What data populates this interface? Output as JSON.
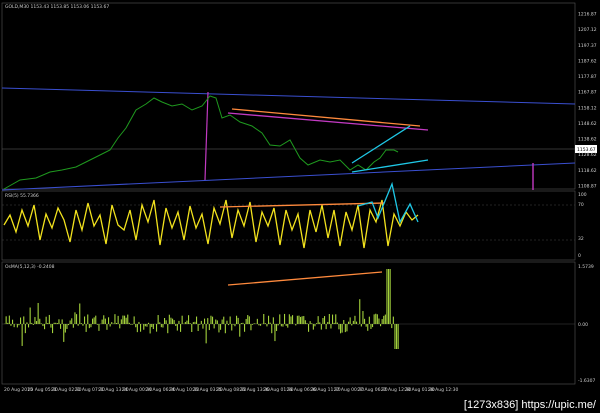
{
  "watermark": "[1273x836] https://upic.me/",
  "panels": {
    "main": {
      "header": "GOLD,M30  1153.43 1153.85 1153.06 1153.67",
      "right_axis": [
        "1216.87",
        "1207.12",
        "1197.37",
        "1187.62",
        "1177.87",
        "1167.87",
        "1158.12",
        "1148.62",
        "1138.62",
        "1128.62",
        "1118.62",
        "1108.87"
      ],
      "current_price": "1153.67"
    },
    "rsi": {
      "header": "RSI(5) 55.7366",
      "right_axis": [
        "100",
        "70",
        "32",
        "0"
      ]
    },
    "osma": {
      "header": "OsMA(5,12,3) -0.2408",
      "right_axis": [
        "1.5739",
        "0.00",
        "-1.6307"
      ]
    }
  },
  "time_axis": [
    "20 Aug 2015",
    "20 Aug 05:30",
    "21 Aug 02:30",
    "21 Aug 07:30",
    "21 Aug 13:30",
    "24 Aug 00:30",
    "24 Aug 06:30",
    "24 Aug 10:30",
    "25 Aug 03:30",
    "25 Aug 08:30",
    "25 Aug 13:30",
    "26 Aug 01:30",
    "26 Aug 06:30",
    "26 Aug 11:30",
    "27 Aug 00:30",
    "27 Aug 06:30",
    "27 Aug 12:30",
    "28 Aug 01:30",
    "28 Aug 12:30"
  ],
  "colors": {
    "price": "#1f9a1f",
    "rsi": "#f2e21d",
    "osma": "#a4d23c",
    "channel": "#3a4fd0",
    "orange": "#ff8a3d",
    "magenta": "#c23ac2",
    "cyan": "#1fc8e6",
    "grid": "#444444",
    "text": "#cfcfcf"
  }
}
